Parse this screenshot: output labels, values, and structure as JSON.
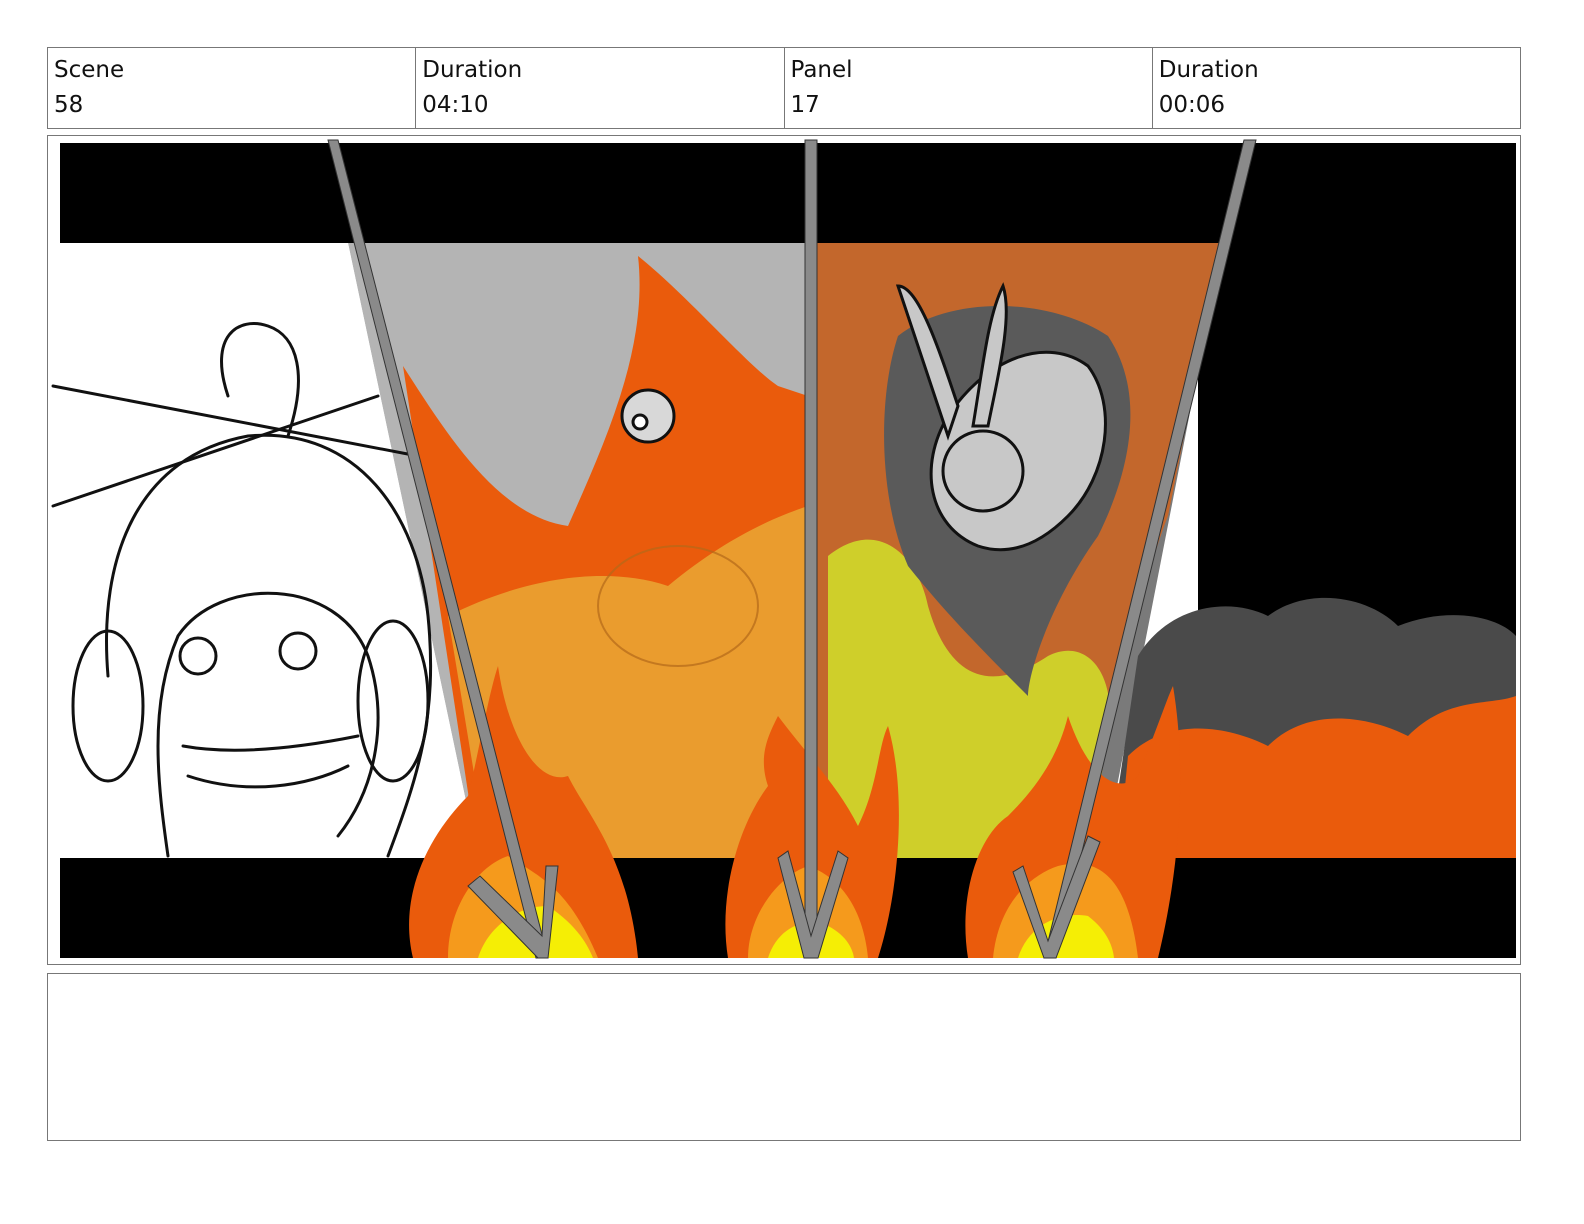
{
  "header": {
    "scene_label": "Scene",
    "scene_value": "58",
    "scene_duration_label": "Duration",
    "scene_duration_value": "04:10",
    "panel_label": "Panel",
    "panel_value": "17",
    "panel_duration_label": "Duration",
    "panel_duration_value": "00:06"
  },
  "panel_image": {
    "colors": {
      "letterbox": "#000000",
      "fire_orange": "#ea5b0c",
      "fire_light": "#f59a1c",
      "fire_yellow": "#f5ee05",
      "fire_yellowgreen": "#cfcf2a",
      "smoke_dark": "#4a4a4a",
      "smoke_gray": "#7a7a7a",
      "bg_gray": "#b4b4b4",
      "divider": "#8a8a8a"
    }
  },
  "notes": {
    "text": ""
  }
}
